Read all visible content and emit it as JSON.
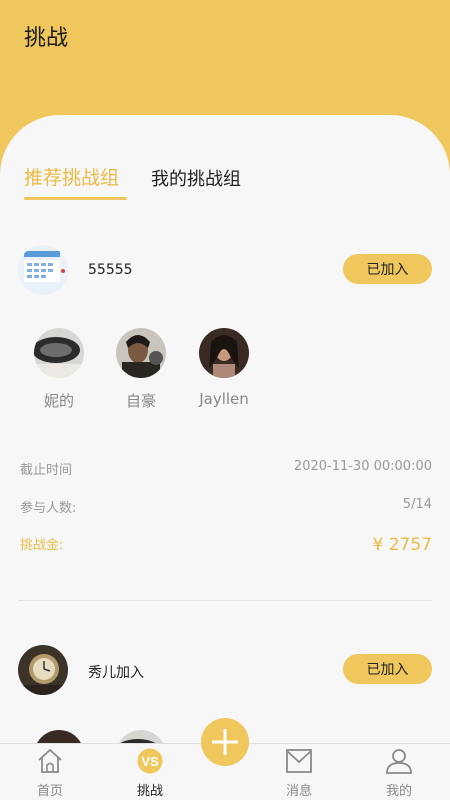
{
  "header": {
    "title": "挑战"
  },
  "tabs": {
    "recommended": "推荐挑战组",
    "mine": "我的挑战组"
  },
  "groups": [
    {
      "name": "55555",
      "join_label": "已加入",
      "members": [
        {
          "name": "妮的"
        },
        {
          "name": "自豪"
        },
        {
          "name": "Jayllen"
        }
      ],
      "deadline_label": "截止时间",
      "deadline_value": "2020-11-30 00:00:00",
      "participants_label": "参与人数:",
      "participants_value": "5/14",
      "prize_label": "挑战金:",
      "prize_value": "¥ 2757"
    },
    {
      "name": "秀儿加入",
      "join_label": "已加入"
    }
  ],
  "tabbar": {
    "home": "首页",
    "challenge": "挑战",
    "messages": "消息",
    "mine": "我的"
  },
  "colors": {
    "accent": "#f0c75c",
    "accent_text": "#e9bb45"
  },
  "icons": [
    "home-icon",
    "challenge-icon",
    "add-icon",
    "message-icon",
    "user-icon"
  ]
}
